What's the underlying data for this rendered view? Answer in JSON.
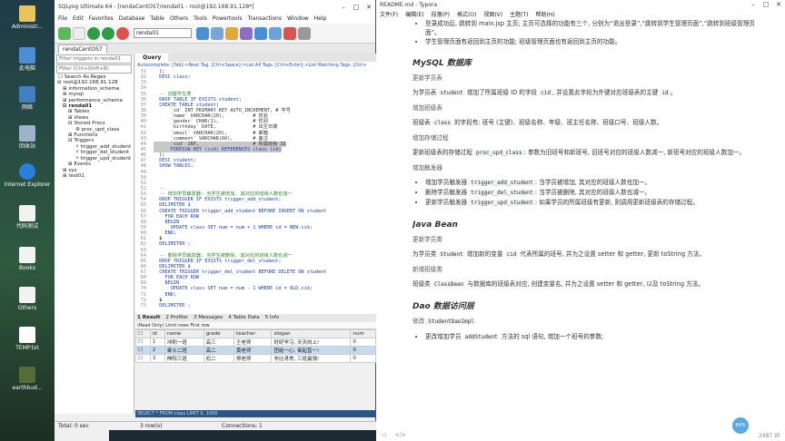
{
  "desktop": {
    "icons": [
      "Administr...",
      "此电脑",
      "网络",
      "回收站",
      "Internet Explorer",
      "代码测试",
      "Books",
      "Others",
      "TEMP.txt",
      "earthbud..."
    ]
  },
  "sqlyog": {
    "title": "SQLyog Ultimate 64 - [rendaCentOS7/renda01 - root@192.168.91.128*]",
    "menu": [
      "File",
      "Edit",
      "Favorites",
      "Database",
      "Table",
      "Others",
      "Tools",
      "Powertools",
      "Transactions",
      "Window",
      "Help"
    ],
    "db_select": "renda01",
    "conn_tab": "rendaCentOS7",
    "filter_placeholder": "Filter triggers in renda01",
    "filter2": "Filter (Ctrl+Shift+B)",
    "search_as_regex": "Search As Regex",
    "tree": [
      "root@192.168.91.128",
      "information_schema",
      "mysql",
      "performance_schema",
      "renda01",
      "Tables",
      "Views",
      "Stored Procs",
      "proc_upd_class",
      "Functions",
      "Triggers",
      "trigger_add_student",
      "trigger_del_student",
      "trigger_upd_student",
      "Events",
      "sys",
      "test01"
    ],
    "query_tab": "Query",
    "autocomplete": "Autocomplete: [Tab]->Next Tag. [Ctrl+Space]->List All Tags. [Ctrl+Enter]->List Matching Tags. [Ctrl+",
    "code": [
      {
        "n": "31",
        "t": "  );"
      },
      {
        "n": "32",
        "t": "  DESC class;"
      },
      {
        "n": "33",
        "t": ""
      },
      {
        "n": "34",
        "t": ""
      },
      {
        "n": "35",
        "t": "  -- 创建学生表"
      },
      {
        "n": "36",
        "t": "  DROP TABLE IF EXISTS student;"
      },
      {
        "n": "37",
        "t": "  CREATE TABLE student("
      },
      {
        "n": "38",
        "t": "      `id` INT PRIMARY KEY AUTO_INCREMENT, # 学号"
      },
      {
        "n": "39",
        "t": "      `name` VARCHAR(20),          # 姓名"
      },
      {
        "n": "40",
        "t": "      `gender` CHAR(1),            # 性别"
      },
      {
        "n": "41",
        "t": "      `birthday` DATE,             # 出生日期"
      },
      {
        "n": "42",
        "t": "      `email` VARCHAR(20),         # 邮箱"
      },
      {
        "n": "43",
        "t": "      `comment` VARCHAR(60),       # 备注"
      },
      {
        "n": "44",
        "t": "      `cid` INT,                   # 所属班级 ID"
      },
      {
        "n": "45",
        "t": "      FOREIGN KEY (cid) REFERENCES class (id)"
      },
      {
        "n": "46",
        "t": "  );"
      },
      {
        "n": "47",
        "t": "  DESC student;"
      },
      {
        "n": "48",
        "t": "  SHOW TABLES;"
      },
      {
        "n": "49",
        "t": ""
      },
      {
        "n": "50",
        "t": ""
      },
      {
        "n": "51",
        "t": ""
      },
      {
        "n": "52",
        "t": "  -- "
      },
      {
        "n": "53",
        "t": "  -- 增加学员触发器: 当学生被增加, 其对应的班级人数也加一"
      },
      {
        "n": "54",
        "t": "  DROP TRIGGER IF EXISTS trigger_add_student;"
      },
      {
        "n": "55",
        "t": "  DELIMITER $"
      },
      {
        "n": "56",
        "t": "  CREATE TRIGGER trigger_add_student BEFORE INSERT ON student"
      },
      {
        "n": "57",
        "t": "    FOR EACH ROW"
      },
      {
        "n": "58",
        "t": "    BEGIN"
      },
      {
        "n": "59",
        "t": "      UPDATE class SET num = num + 1 WHERE id = NEW.cid;"
      },
      {
        "n": "60",
        "t": "    END;"
      },
      {
        "n": "61",
        "t": "  $"
      },
      {
        "n": "62",
        "t": "  DELIMITER ;"
      },
      {
        "n": "63",
        "t": ""
      },
      {
        "n": "64",
        "t": "  -- 删除学员触发器: 当学生被删除, 其对应的班级人数也减一"
      },
      {
        "n": "65",
        "t": "  DROP TRIGGER IF EXISTS trigger_del_student;"
      },
      {
        "n": "66",
        "t": "  DELIMITER $"
      },
      {
        "n": "67",
        "t": "  CREATE TRIGGER trigger_del_student BEFORE DELETE ON student"
      },
      {
        "n": "68",
        "t": "    FOR EACH ROW"
      },
      {
        "n": "69",
        "t": "    BEGIN"
      },
      {
        "n": "70",
        "t": "      UPDATE class SET num = num - 1 WHERE id = OLD.cid;"
      },
      {
        "n": "71",
        "t": "    END;"
      },
      {
        "n": "72",
        "t": "  $"
      },
      {
        "n": "73",
        "t": "  DELIMITER ;"
      }
    ],
    "result_tabs": [
      "1 Result",
      "2 Profiler",
      "3 Messages",
      "4 Table Data",
      "5 Info"
    ],
    "result_bar": "(Read Only)   Limit rows  First row",
    "columns": [
      "id",
      "name",
      "grade",
      "teacher",
      "slogan",
      "num"
    ],
    "rows": [
      [
        "1",
        "冲刺一班",
        "高三",
        "王老师",
        "好好学习, 天天向上!",
        "0"
      ],
      [
        "2",
        "奋斗二班",
        "高二",
        "黄老师",
        "团结一心, 奋起直一!",
        "0"
      ],
      [
        "3",
        "伸阳三班",
        "初二",
        "郑老师",
        "非比寻常, 三班最强!",
        "0"
      ]
    ],
    "sql_line": "SELECT * FROM class LIMIT 0, 1000",
    "status": {
      "exec": "Total: 0 sec",
      "rows": "3 row(s)",
      "conn": "Connections: 1"
    }
  },
  "typora": {
    "title": "README.md - Typora",
    "menu": [
      "文件(F)",
      "编辑(E)",
      "段落(P)",
      "格式(O)",
      "视图(V)",
      "主题(T)",
      "帮助(H)"
    ],
    "b1": "登录成功后, 跳转到 main.jsp 主页; 主页可选择的功能有三个, 分别为“退出登录”,“跳转到学生管理页面”,“跳转到班级管理页面”。",
    "b2": "学生管理页面有返回到主页的功能; 班级管理页面也有返回到主页的功能。",
    "h_mysql": "MySQL 数据库",
    "s1": "更新学员表",
    "p1a": "为学员表",
    "p1code": "student",
    "p1b": "增加了所属班级 ID 的字段",
    "p1code2": "cid",
    "p1c": ", 并设置此字段为外键对应班级表的主键",
    "p1code3": "id",
    "s2": "增加班级表",
    "p2a": "班级表",
    "p2code": "class",
    "p2b": "的字段有: 班号 (主键)、班级名称、年级、班主任名称、班级口号、班级人数。",
    "s3": "增加存储过程",
    "p3a": "更新班级表的存储过程",
    "p3code": "proc_upd_class",
    "p3b": ": 参数为旧班号和新班号, 旧班号对应的班级人数减一, 新班号对应的班级人数加一。",
    "s4": "增加触发器",
    "t1a": "增加学员触发器",
    "t1code": "trigger_add_student",
    "t1b": ": 当学员被增加, 其对应的班级人数也加一。",
    "t2a": "删除学员触发器",
    "t2code": "trigger_del_student",
    "t2b": ": 当学员被删除, 其对应的班级人数也减一。",
    "t3a": "更新学员触发器",
    "t3code": "trigger_upd_student",
    "t3b": ": 如果学员的所属班级有更新, 则调用更新班级表的存储过程。",
    "h_java": "Java Bean",
    "s5": "更新学员类",
    "p5a": "为学员类",
    "p5code": "Student",
    "p5b": "增加新的变量",
    "p5code2": "cid",
    "p5c": "代表所属的班号, 并为之设置 setter 和 getter, 更新 toString 方法。",
    "s6": "新增班级类",
    "p6a": "班级类",
    "p6code": "ClassBean",
    "p6b": "与数据库的班级表对应, 创建变量名, 并为之设置 setter 和 getter, 以及 toString 方法。",
    "h_dao": "Dao 数据访问层",
    "s7a": "修改",
    "s7code": "StudentDaoImpl",
    "b3a": "更改增加学员",
    "b3code": "addStudent",
    "b3b": "方法的 sql 语句, 增加一个班号的参数;",
    "words": "2487 词",
    "badge": "64%"
  }
}
